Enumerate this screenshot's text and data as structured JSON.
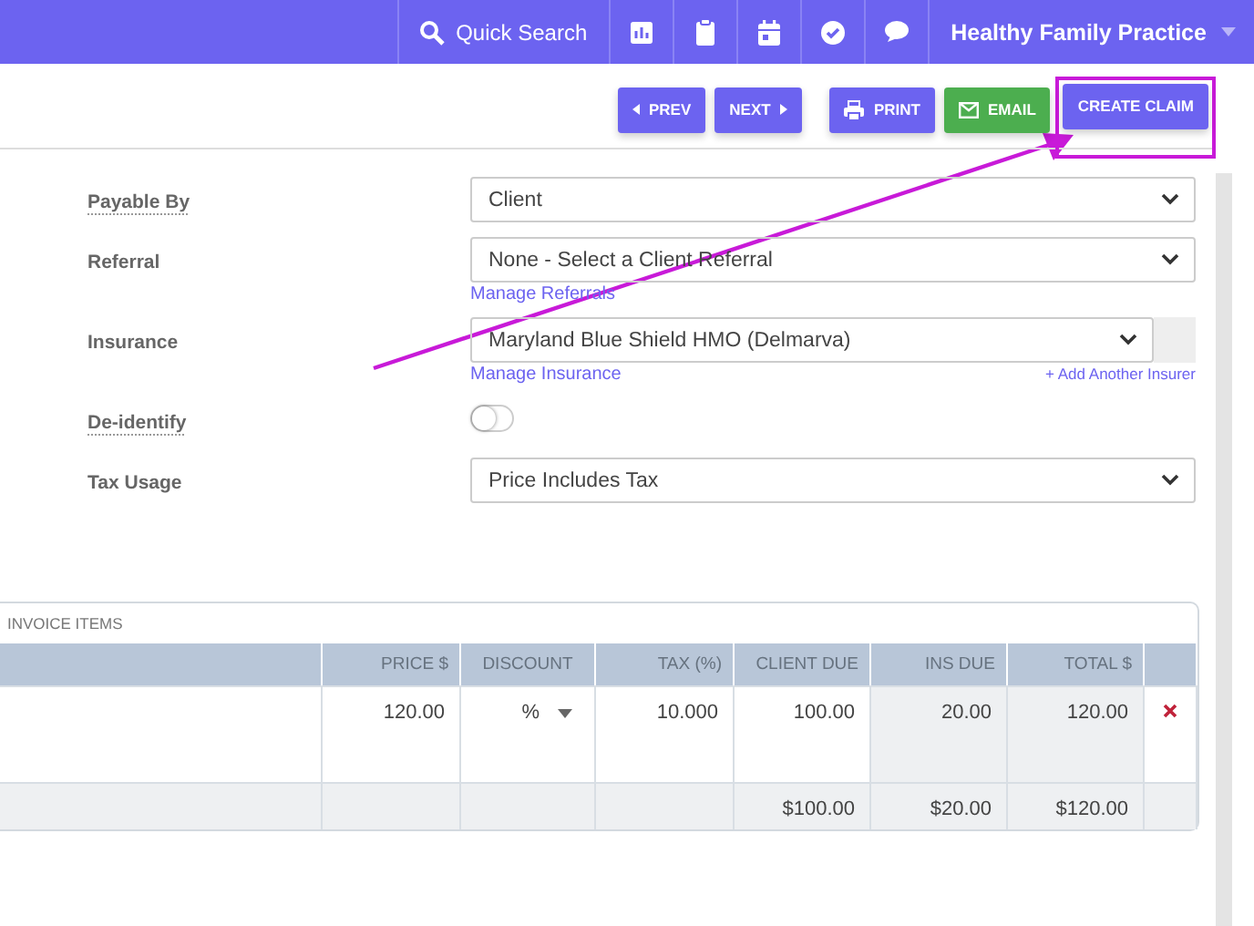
{
  "topbar": {
    "search_label": "Quick Search",
    "practice": "Healthy Family Practice"
  },
  "toolbar": [
    {
      "label": "PREV",
      "kind": "prev",
      "highlighted": false
    },
    {
      "label": "NEXT",
      "kind": "next",
      "highlighted": false
    },
    {
      "label": "PRINT",
      "kind": "print",
      "highlighted": false
    },
    {
      "label": "EMAIL",
      "kind": "email",
      "highlighted": false
    },
    {
      "label": "CREATE CLAIM",
      "kind": "claim",
      "highlighted": true
    }
  ],
  "form": [
    {
      "label": "Payable By",
      "kind": "select",
      "value": "Client",
      "dotted": true
    },
    {
      "label": "Referral",
      "kind": "select",
      "value": "None - Select a Client Referral",
      "dotted": false,
      "link": "Manage Referrals"
    },
    {
      "label": "Insurance",
      "kind": "insurance",
      "value": "Maryland Blue Shield HMO (Delmarva)",
      "dotted": false,
      "link": "Manage Insurance",
      "link_right": "+ Add Another Insurer"
    },
    {
      "label": "De-identify",
      "kind": "toggle",
      "on": false,
      "dotted": true
    },
    {
      "label": "Tax Usage",
      "kind": "select",
      "value": "Price Includes Tax",
      "dotted": false
    }
  ],
  "invoice": {
    "title": "INVOICE ITEMS",
    "columns": [
      "PRICE $",
      "DISCOUNT",
      "TAX (%)",
      "CLIENT DUE",
      "INS DUE",
      "TOTAL $"
    ],
    "rows": [
      {
        "price": "120.00",
        "discount": "%",
        "tax": "10.000",
        "client_due": "100.00",
        "ins_due": "20.00",
        "total": "120.00"
      }
    ],
    "totals": {
      "client_due": "$100.00",
      "ins_due": "$20.00",
      "total": "$120.00"
    }
  }
}
